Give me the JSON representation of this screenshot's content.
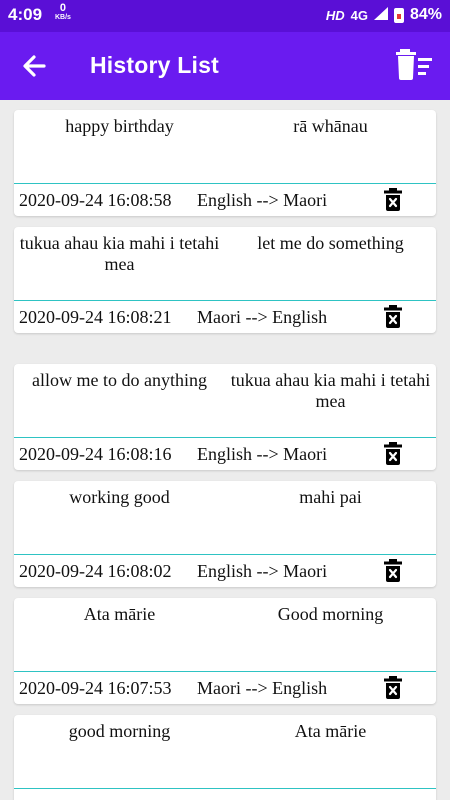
{
  "status_bar": {
    "time": "4:09",
    "net_speed": "0",
    "net_unit": "KB/s",
    "hd": "HD",
    "signal": "4G",
    "battery": "84%"
  },
  "app_bar": {
    "title": "History List",
    "back_icon": "arrow-back-icon",
    "clear_icon": "delete-sweep-icon",
    "color": "#6a1bf0"
  },
  "history": [
    {
      "source": "happy birthday",
      "translation": "rā whānau",
      "timestamp": "2020-09-24 16:08:58",
      "direction": "English --> Maori"
    },
    {
      "source": "tukua ahau kia mahi i tetahi mea",
      "translation": "let me do something",
      "timestamp": "2020-09-24 16:08:21",
      "direction": "Maori --> English"
    },
    {
      "source": "allow me to do anything",
      "translation": "tukua ahau kia mahi i tetahi mea",
      "timestamp": "2020-09-24 16:08:16",
      "direction": "English --> Maori"
    },
    {
      "source": "working good",
      "translation": "mahi pai",
      "timestamp": "2020-09-24 16:08:02",
      "direction": "English --> Maori"
    },
    {
      "source": "Ata mārie",
      "translation": "Good morning",
      "timestamp": "2020-09-24 16:07:53",
      "direction": "Maori --> English"
    },
    {
      "source": "good morning",
      "translation": "Ata mārie",
      "timestamp": "",
      "direction": ""
    }
  ],
  "accent_divider": "#2ec3c3"
}
